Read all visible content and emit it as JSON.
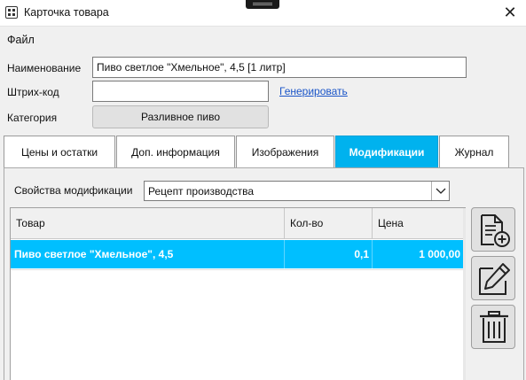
{
  "window": {
    "title": "Карточка товара",
    "app_icon": "product-card-icon",
    "close_glyph": "✕"
  },
  "menu": {
    "file": "Файл"
  },
  "form": {
    "name_label": "Наименование",
    "name_value": "Пиво светлое \"Хмельное\", 4,5 [1 литр]",
    "barcode_label": "Штрих-код",
    "barcode_value": "",
    "generate_link": "Генерировать",
    "category_label": "Категория",
    "category_value": "Разливное пиво"
  },
  "tabs": [
    {
      "label": "Цены и остатки",
      "active": false
    },
    {
      "label": "Доп. информация",
      "active": false
    },
    {
      "label": "Изображения",
      "active": false
    },
    {
      "label": "Модификации",
      "active": true
    },
    {
      "label": "Журнал",
      "active": false
    }
  ],
  "modifications": {
    "props_label": "Свойства модификации",
    "props_value": "Рецепт производства",
    "columns": [
      "Товар",
      "Кол-во",
      "Цена"
    ],
    "rows": [
      {
        "product": "Пиво светлое \"Хмельное\", 4,5",
        "qty": "0,1",
        "price": "1 000,00",
        "selected": true
      }
    ],
    "buttons": [
      "add-document-icon",
      "edit-pencil-icon",
      "trash-icon"
    ]
  },
  "colors": {
    "accent": "#00b2ee",
    "selected_row": "#00bfff",
    "link": "#1a55c8"
  }
}
